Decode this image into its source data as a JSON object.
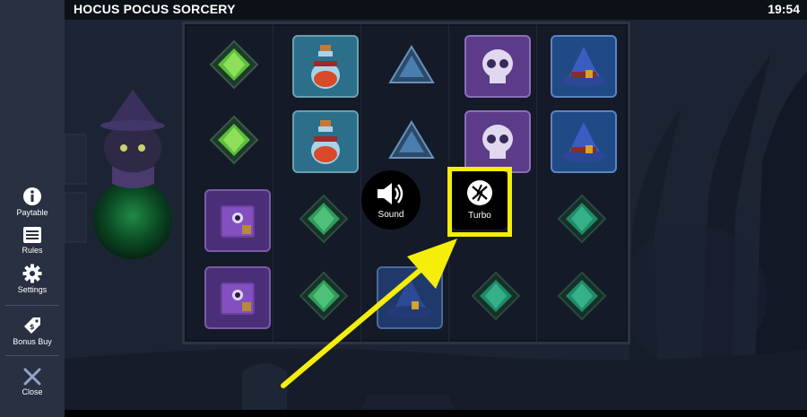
{
  "header": {
    "title": "HOCUS POCUS SORCERY",
    "clock": "19:54"
  },
  "sidebar": {
    "items": [
      {
        "label": "Paytable",
        "icon": "info-icon"
      },
      {
        "label": "Rules",
        "icon": "list-icon"
      },
      {
        "label": "Settings",
        "icon": "gear-icon"
      },
      {
        "label": "Bonus Buy",
        "icon": "price-tag-icon"
      },
      {
        "label": "Close",
        "icon": "close-icon"
      }
    ]
  },
  "overlay": {
    "sound_label": "Sound",
    "turbo_label": "Turbo"
  },
  "reels": [
    [
      "green-gem",
      "potion",
      "blue-triangle",
      "skull",
      "wizard-hat"
    ],
    [
      "green-gem",
      "potion",
      "blue-triangle",
      "skull",
      "wizard-hat"
    ],
    [
      "spellbook",
      "green-gem",
      "",
      "",
      "teal-gem"
    ],
    [
      "spellbook",
      "green-gem",
      "wizard-hat",
      "teal-gem",
      "teal-gem"
    ]
  ],
  "colors": {
    "highlight": "#f5ee0a",
    "sidebar": "#283042"
  }
}
